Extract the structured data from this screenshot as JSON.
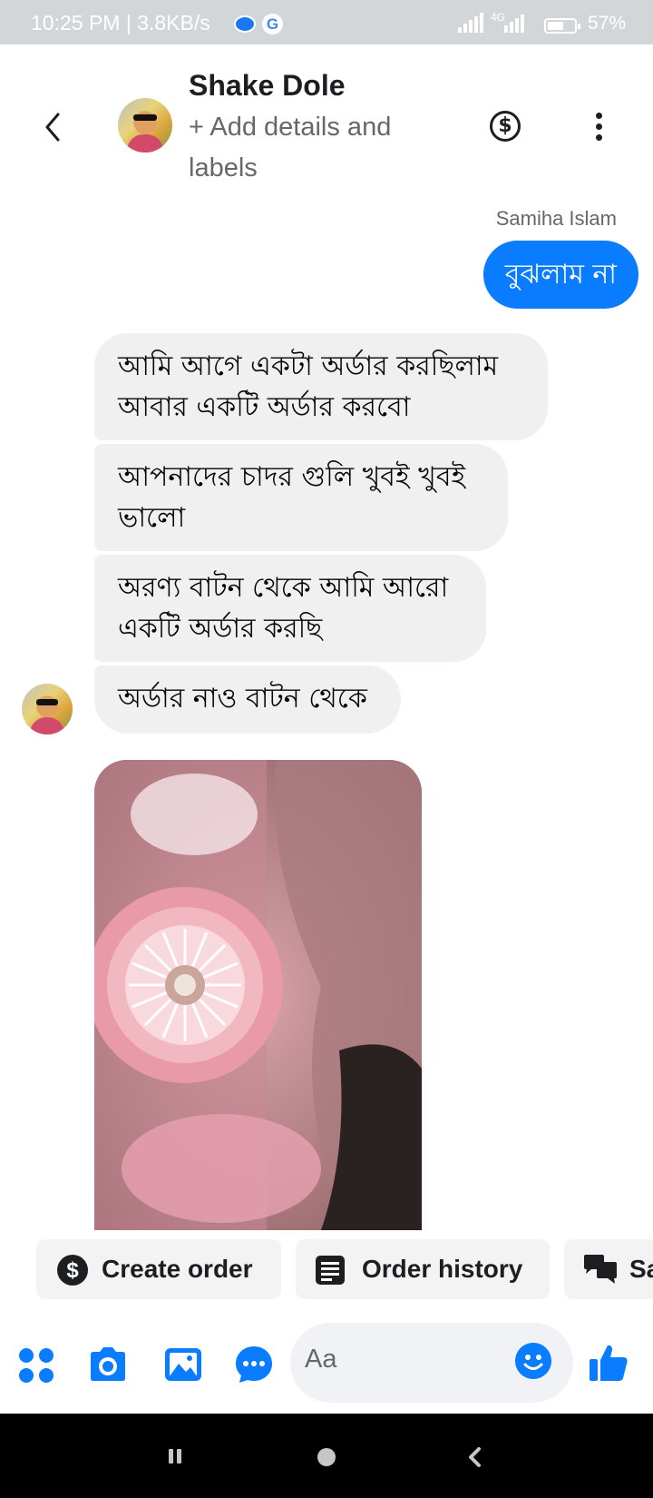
{
  "status_bar": {
    "time_speed": "10:25 PM | 3.8KB/s",
    "network_label": "4G",
    "battery": "57%",
    "battery_level_fraction": 0.57
  },
  "header": {
    "contact_name": "Shake Dole",
    "add_details": "+ Add details and labels",
    "dollar_symbol": "$",
    "icons": [
      "back-chevron-icon",
      "contact-avatar",
      "dollar-icon",
      "more-vert-icon"
    ]
  },
  "messages": {
    "outgoing_sender": "Samiha Islam",
    "outgoing": "বুঝলাম না",
    "incoming": [
      "আমি আগে একটা অর্ডার করছিলাম আবার একটি অর্ডার করবো",
      "আপনাদের চাদর গুলি খুবই খুবই ভালো",
      "অরণ্য বাটন থেকে আমি আরো একটি অর্ডার করছি",
      "অর্ডার নাও বাটন থেকে"
    ]
  },
  "quick_replies": [
    {
      "label": "Create order",
      "icon": "dollar-circle-icon"
    },
    {
      "label": "Order history",
      "icon": "receipt-icon"
    },
    {
      "label": "Sa",
      "icon": "chat-bubbles-icon"
    }
  ],
  "composer": {
    "placeholder": "Aa",
    "icons": [
      "apps-grid-icon",
      "camera-icon",
      "gallery-icon",
      "chat-dots-icon",
      "emoji-icon",
      "thumbs-up-icon"
    ]
  },
  "colors": {
    "accent": "#0a7cff",
    "incoming_bubble": "#f0f0f0",
    "status_bar": "#d3d6d9",
    "nav_bar": "#000000"
  }
}
